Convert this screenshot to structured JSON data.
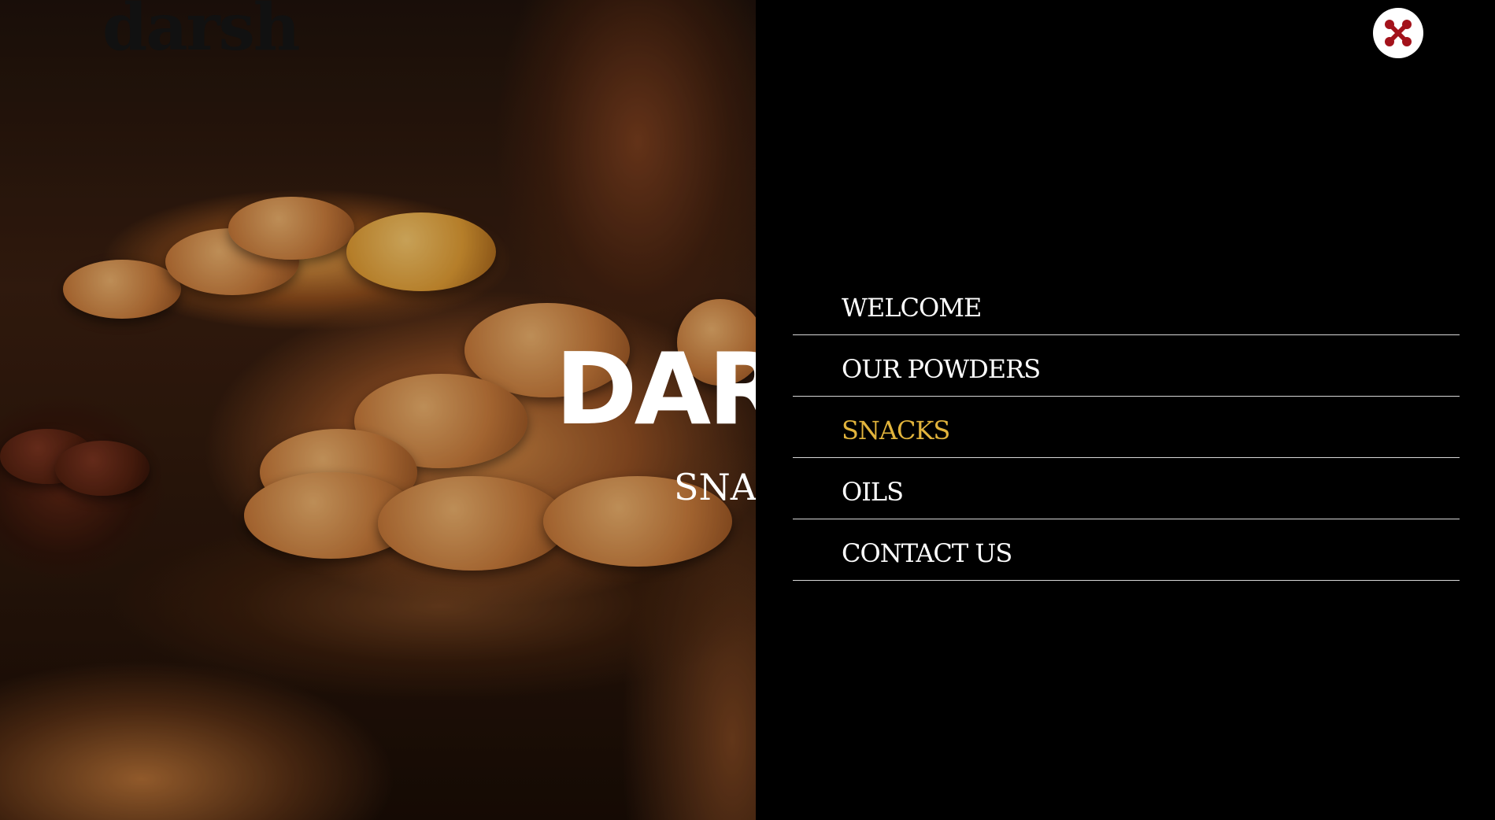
{
  "header": {
    "logo_text": "darsh",
    "close_icon_color": "#a3121b"
  },
  "hero": {
    "title": "DAR",
    "subtitle": "SNA"
  },
  "menu": {
    "active_color": "#e2b43c",
    "items": [
      {
        "label": "WELCOME",
        "active": false
      },
      {
        "label": "OUR POWDERS",
        "active": false
      },
      {
        "label": "SNACKS",
        "active": true
      },
      {
        "label": "OILS",
        "active": false
      },
      {
        "label": "CONTACT US",
        "active": false
      }
    ]
  }
}
